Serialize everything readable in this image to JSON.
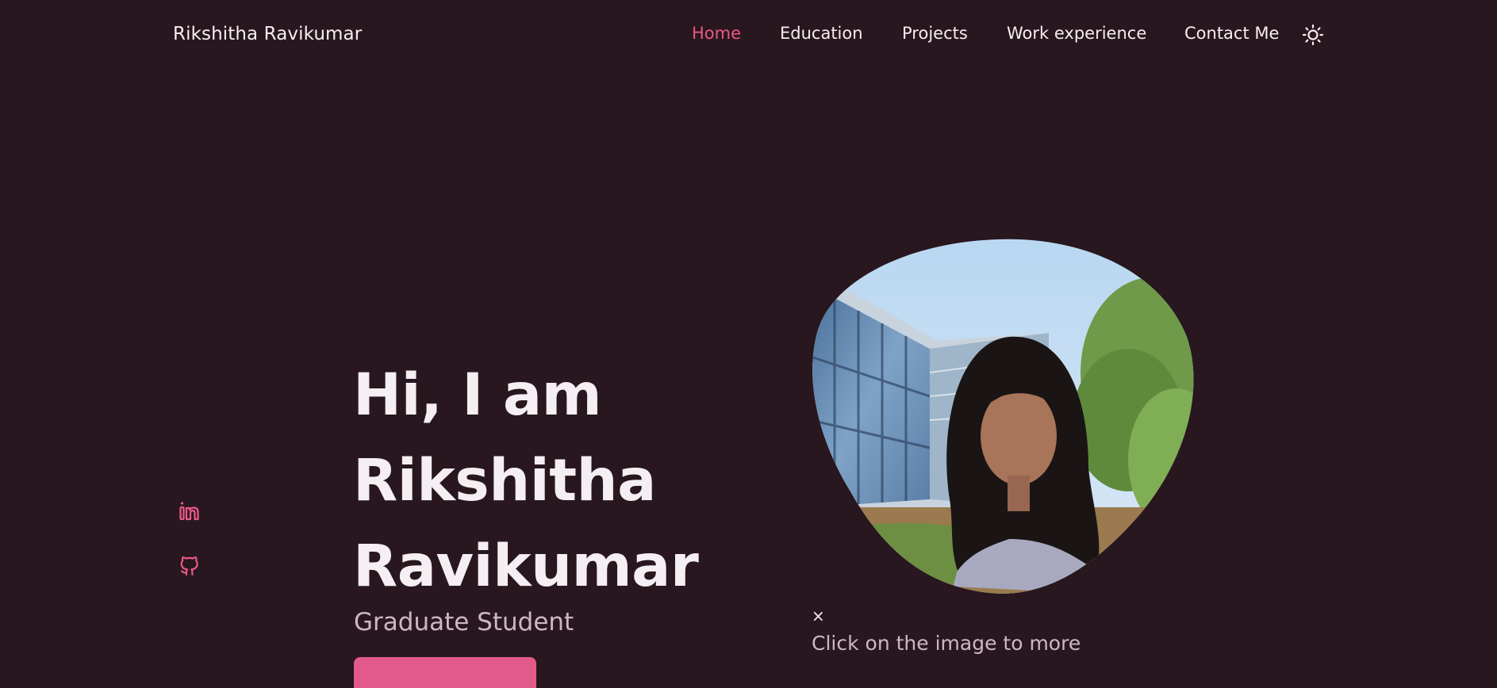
{
  "header": {
    "logo": "Rikshitha Ravikumar",
    "nav": {
      "home": "Home",
      "education": "Education",
      "projects": "Projects",
      "work": "Work experience",
      "contact": "Contact Me"
    },
    "theme_icon": "sun-icon"
  },
  "social": {
    "icons": [
      "linkedin-icon",
      "github-icon"
    ]
  },
  "hero": {
    "title_line1": "Hi, I am",
    "title_line2": "Rikshitha",
    "title_line3": "Ravikumar",
    "subtitle": "Graduate Student",
    "button_label": ""
  },
  "profile": {
    "close_label": "×",
    "hint": "Click on the image to more"
  },
  "colors": {
    "background": "#28171e",
    "accent": "#e9578a",
    "text": "#f5eef2",
    "muted": "#cdb7c2",
    "button": "#e25a8a"
  }
}
